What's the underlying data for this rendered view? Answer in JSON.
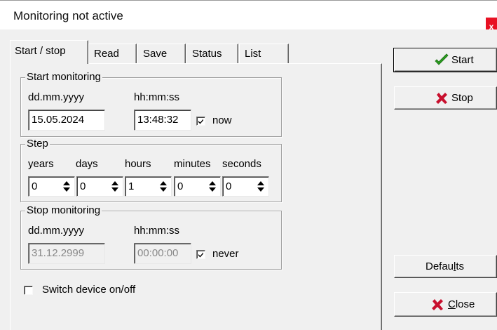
{
  "window": {
    "title": "Monitoring not active",
    "close_label": "x"
  },
  "tabs": [
    {
      "label": "Start / stop",
      "active": true
    },
    {
      "label": "Read"
    },
    {
      "label": "Save"
    },
    {
      "label": "Status"
    },
    {
      "label": "List"
    }
  ],
  "start_monitoring": {
    "legend": "Start monitoring",
    "date_label": "dd.mm.yyyy",
    "time_label": "hh:mm:ss",
    "date_value": "15.05.2024",
    "time_value": "13:48:32",
    "now_label": "now",
    "now_checked": true
  },
  "step": {
    "legend": "Step",
    "labels": [
      "years",
      "days",
      "hours",
      "minutes",
      "seconds"
    ],
    "values": [
      "0",
      "0",
      "1",
      "0",
      "0"
    ]
  },
  "stop_monitoring": {
    "legend": "Stop monitoring",
    "date_label": "dd.mm.yyyy",
    "time_label": "hh:mm:ss",
    "date_value": "31.12.2999",
    "time_value": "00:00:00",
    "never_label": "never",
    "never_checked": true
  },
  "switch_device": {
    "label": "Switch device on/off",
    "checked": false
  },
  "buttons": {
    "start_label": "Start",
    "stop_label": "Stop",
    "defaults_label": "Defaults",
    "defaults_mnemonic_before": "Defau",
    "defaults_mnemonic_char": "l",
    "defaults_mnemonic_after": "ts",
    "close_mnemonic_char": "C",
    "close_mnemonic_after": "lose"
  },
  "colors": {
    "close_red": "#e81123",
    "check_green": "#2a9d1f",
    "x_red": "#c8102e"
  }
}
